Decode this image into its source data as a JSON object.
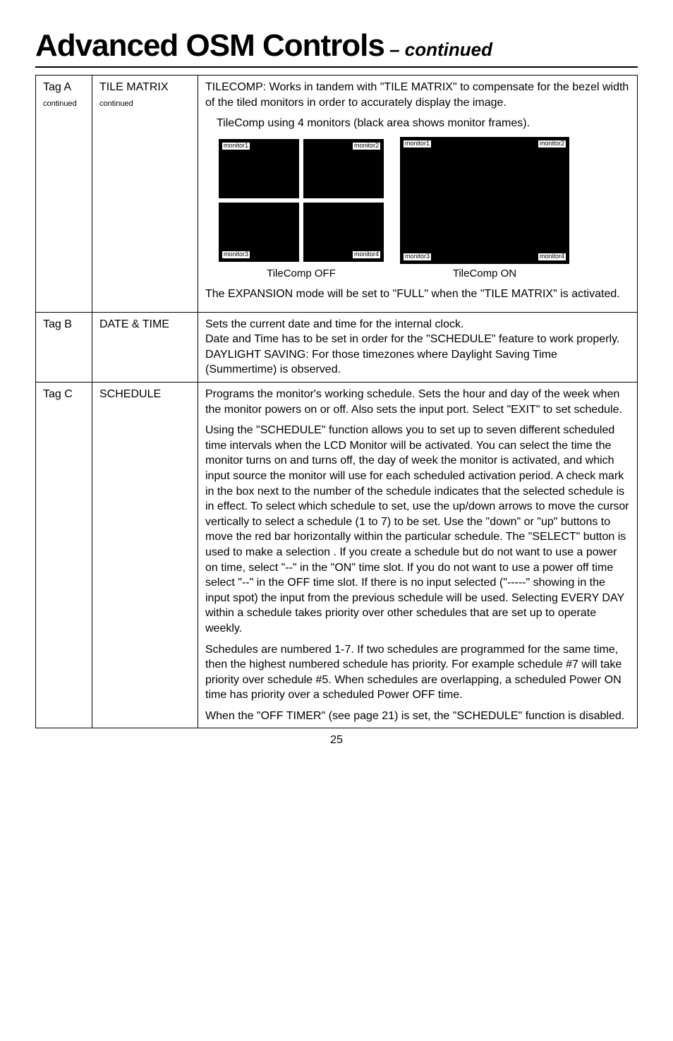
{
  "title_main": "Advanced OSM Controls",
  "title_sub": " – continued",
  "rows": {
    "r1": {
      "tag": "Tag A",
      "tag_sub": "continued",
      "item": "TILE MATRIX",
      "item_sub": "continued",
      "p1": "TILECOMP: Works in tandem with \"TILE MATRIX\" to compensate for the bezel width of the tiled monitors in order to accurately display the image.",
      "p2": "TileComp using 4 monitors (black area shows monitor frames).",
      "fig_off": "TileComp OFF",
      "fig_on": "TileComp ON",
      "m1": "monitor1",
      "m2": "monitor2",
      "m3": "monitor3",
      "m4": "monitor4",
      "p3": "The EXPANSION mode will be set to \"FULL\" when the \"TILE MATRIX\" is activated."
    },
    "r2": {
      "tag": "Tag B",
      "item": "DATE & TIME",
      "p1": "Sets the current date and time for the internal clock.",
      "p2": "Date and Time has to be set in order for the \"SCHEDULE\" feature to work properly.",
      "p3": "DAYLIGHT SAVING: For those timezones where Daylight Saving Time (Summertime) is observed."
    },
    "r3": {
      "tag": "Tag C",
      "item": "SCHEDULE",
      "p1": "Programs the monitor's working schedule. Sets the hour and day of the week when the monitor powers on or off. Also sets the input port. Select \"EXIT\" to set schedule.",
      "p2": "Using the \"SCHEDULE\" function allows you to set up to seven different scheduled time intervals when the LCD Monitor will be activated.  You can select the time the monitor turns on and turns off, the day of week the monitor is activated, and which input source the monitor will use for each scheduled activation period.  A check mark in the box next to the number of the schedule indicates that the selected schedule is in effect. To select which schedule to set, use the up/down arrows to move the cursor vertically to select a schedule (1 to 7) to be set.  Use the \"down\" or \"up\" buttons to move the red bar horizontally within the particular schedule. The \"SELECT\" button is used to make a selection . If you create a schedule but do not want to use a power on time, select \"--\" in the \"ON\" time slot. If you do not want to use a power off time select \"--\" in the OFF time slot. If there is no input selected (\"-----\" showing in the input spot) the input from the previous schedule will be used. Selecting EVERY DAY within a schedule takes priority over other schedules that are set up to operate weekly.",
      "p3": "Schedules are numbered 1-7. If two schedules are programmed for the same time, then the highest numbered schedule has priority. For example schedule #7 will take priority over schedule #5. When schedules are overlapping, a scheduled Power ON time has priority over a scheduled Power OFF time.",
      "p4": "When the \"OFF TIMER\" (see page 21) is set, the \"SCHEDULE\" function is disabled."
    }
  },
  "page": "25"
}
